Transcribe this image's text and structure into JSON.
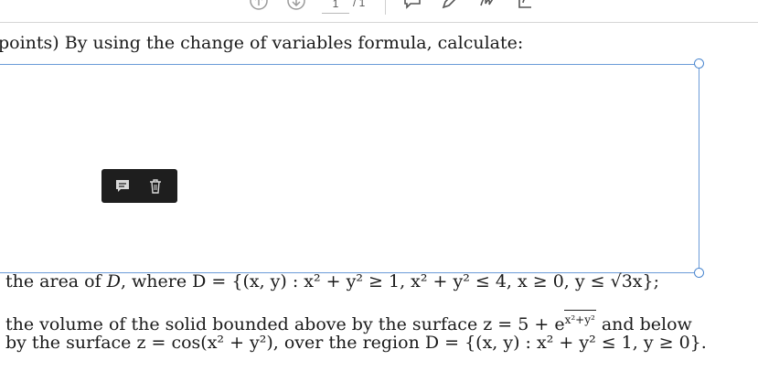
{
  "toolbar": {
    "page_current": "1",
    "page_total": "/ 1",
    "icons": [
      "arrow-up-circle-icon",
      "arrow-down-circle-icon",
      "comment-icon",
      "pen-icon",
      "signature-icon",
      "share-icon"
    ]
  },
  "question": {
    "intro": "points) By using the change of variables formula, calculate:"
  },
  "items": {
    "area": {
      "prefix": "the area of ",
      "var": "D",
      "mid": ", where ",
      "formula": "D = {(x, y) : x² + y² ≥ 1, x² + y² ≤ 4, x ≥ 0, y ≤ √3x};"
    },
    "volume": {
      "line1_prefix": "the volume of the solid bounded above by the surface ",
      "line1_formula": "z = 5 + e",
      "line1_exponent": "x²+y²",
      "line1_suffix": " and below",
      "line2": "by the surface z = cos(x² + y²), over the region D = {(x, y) : x² + y² ≤ 1, y ≥ 0}."
    }
  },
  "colors": {
    "selection": "#6b9bd8",
    "popup_bg": "#1e1e1e",
    "text": "#1a1a1a"
  }
}
